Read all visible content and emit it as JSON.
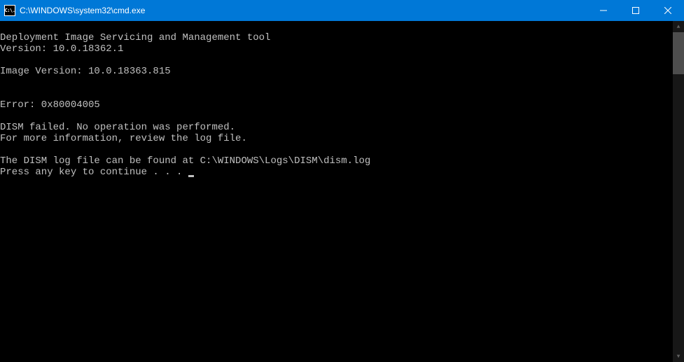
{
  "window": {
    "title": "C:\\WINDOWS\\system32\\cmd.exe",
    "icon_text": "C:\\."
  },
  "terminal": {
    "lines": [
      "",
      "Deployment Image Servicing and Management tool",
      "Version: 10.0.18362.1",
      "",
      "Image Version: 10.0.18363.815",
      "",
      "",
      "Error: 0x80004005",
      "",
      "DISM failed. No operation was performed.",
      "For more information, review the log file.",
      "",
      "The DISM log file can be found at C:\\WINDOWS\\Logs\\DISM\\dism.log",
      "Press any key to continue . . . "
    ]
  }
}
